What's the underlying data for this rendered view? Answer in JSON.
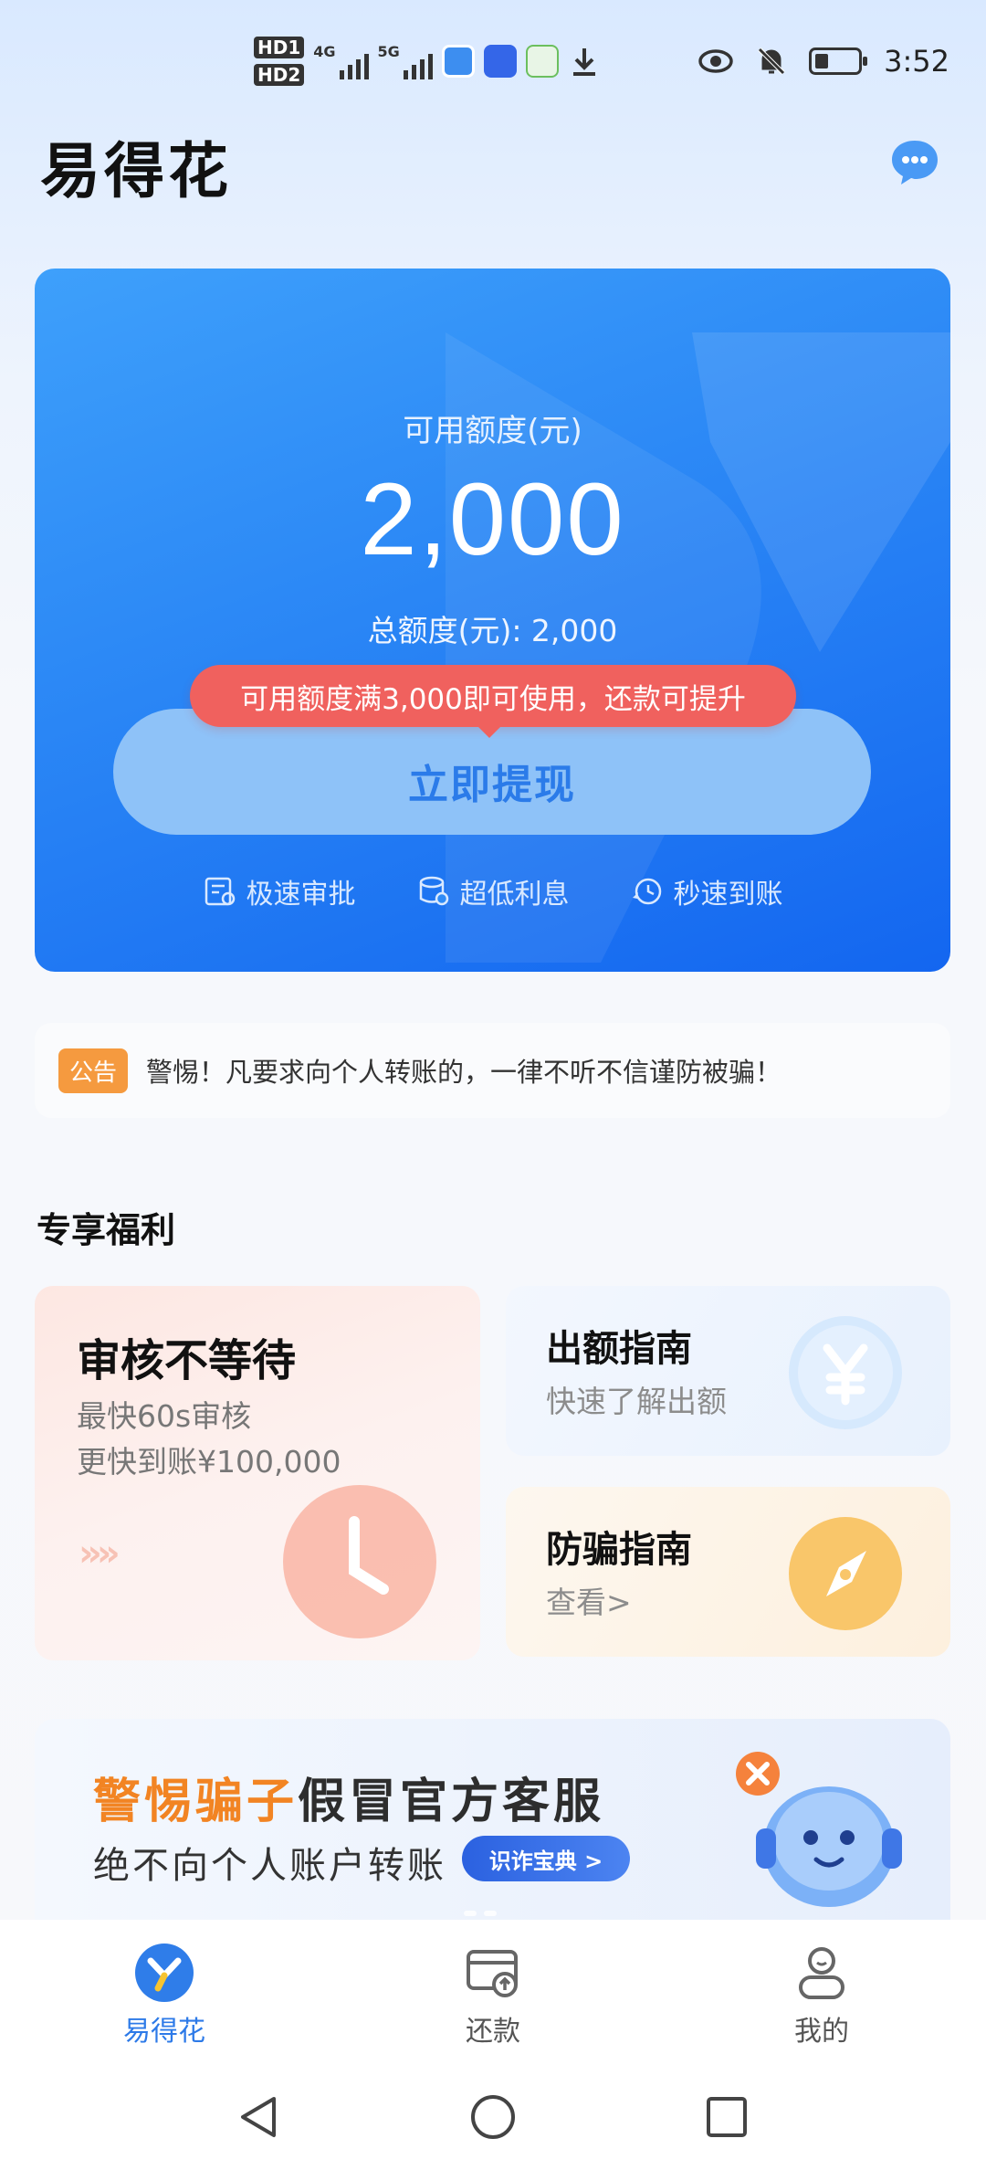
{
  "status_bar": {
    "sim1": "HD1",
    "sim2": "HD2",
    "net1": "4G",
    "net2": "5G",
    "time": "3:52"
  },
  "header": {
    "app_title": "易得花"
  },
  "credit_card": {
    "available_label": "可用额度(元)",
    "available_amount": "2,000",
    "total_label": "总额度(元): 2,000",
    "tip": "可用额度满3,000即可使用，还款可提升",
    "withdraw_button": "立即提现",
    "features": [
      "极速审批",
      "超低利息",
      "秒速到账"
    ]
  },
  "notice": {
    "tag": "公告",
    "text": "警惕！凡要求向个人转账的，一律不听不信谨防被骗！"
  },
  "benefits": {
    "section_title": "专享福利",
    "review": {
      "title": "审核不等待",
      "line1": "最快60s审核",
      "line2": "更快到账¥100,000",
      "arrows": "»»"
    },
    "limit_guide": {
      "title": "出额指南",
      "subtitle": "快速了解出额"
    },
    "fraud_guide": {
      "title": "防骗指南",
      "subtitle": "查看>"
    }
  },
  "banner": {
    "title_warn": "警惕骗子",
    "title_rest": "假冒官方客服",
    "subtitle": "绝不向个人账户转账",
    "button": "识诈宝典 >"
  },
  "bottom_nav": {
    "items": [
      "易得花",
      "还款",
      "我的"
    ],
    "active_index": 0
  },
  "colors": {
    "card_blue": "#2a86f5",
    "accent_red": "#f0615e",
    "notice_orange": "#f59a3f",
    "active_nav": "#2d7ae8"
  }
}
